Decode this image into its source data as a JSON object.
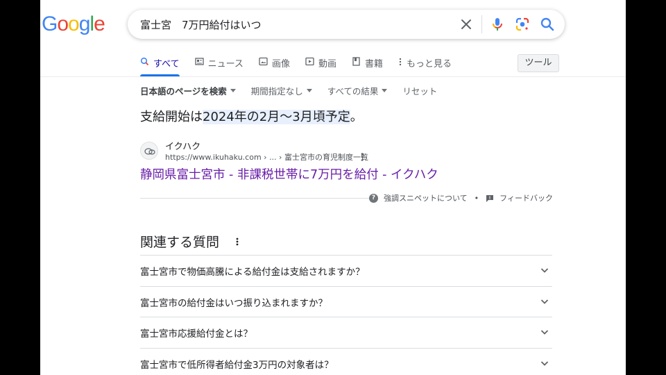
{
  "logo": {
    "letters": [
      {
        "ch": "G",
        "color": "#4285F4"
      },
      {
        "ch": "o",
        "color": "#EA4335"
      },
      {
        "ch": "o",
        "color": "#FBBC05"
      },
      {
        "ch": "g",
        "color": "#4285F4"
      },
      {
        "ch": "l",
        "color": "#34A853"
      },
      {
        "ch": "e",
        "color": "#EA4335"
      }
    ]
  },
  "search": {
    "query": "富士宮　7万円給付はいつ"
  },
  "tabs": [
    {
      "label": "すべて",
      "icon": "search-icon",
      "active": true
    },
    {
      "label": "ニュース",
      "icon": "news-icon",
      "active": false
    },
    {
      "label": "画像",
      "icon": "image-icon",
      "active": false
    },
    {
      "label": "動画",
      "icon": "video-icon",
      "active": false
    },
    {
      "label": "書籍",
      "icon": "book-icon",
      "active": false
    },
    {
      "label": "もっと見る",
      "icon": "more-vert-icon",
      "active": false
    }
  ],
  "tools_button": "ツール",
  "filters": {
    "language": "日本語のページを検索",
    "period": "期間指定なし",
    "results": "すべての結果",
    "reset": "リセット"
  },
  "snippet": {
    "answer_prefix": "支給開始は",
    "answer_highlight": "2024年の2月～3月頃予定",
    "answer_suffix": "。",
    "site_name": "イクハク",
    "site_url": "https://www.ikuhaku.com › ... › 富士宮市の育児制度一覧",
    "title": "静岡県富士宮市 - 非課税世帯に7万円を給付 - イクハク",
    "about_label": "強調スニペットについて",
    "separator": "•",
    "feedback_label": "フィードバック"
  },
  "paa": {
    "title": "関連する質問",
    "questions": [
      "富士宮市で物価高騰による給付金は支給されますか？",
      "富士宮市の給付金はいつ振り込まれますか？",
      "富士宮市応援給付金とは？",
      "富士宮市で低所得者給付金3万円の対象者は？"
    ]
  },
  "colors": {
    "link_visited": "#681da8",
    "active_tab": "#1a0dab",
    "tab_indicator": "#1a73e8",
    "highlight": "#e8f0fe"
  }
}
